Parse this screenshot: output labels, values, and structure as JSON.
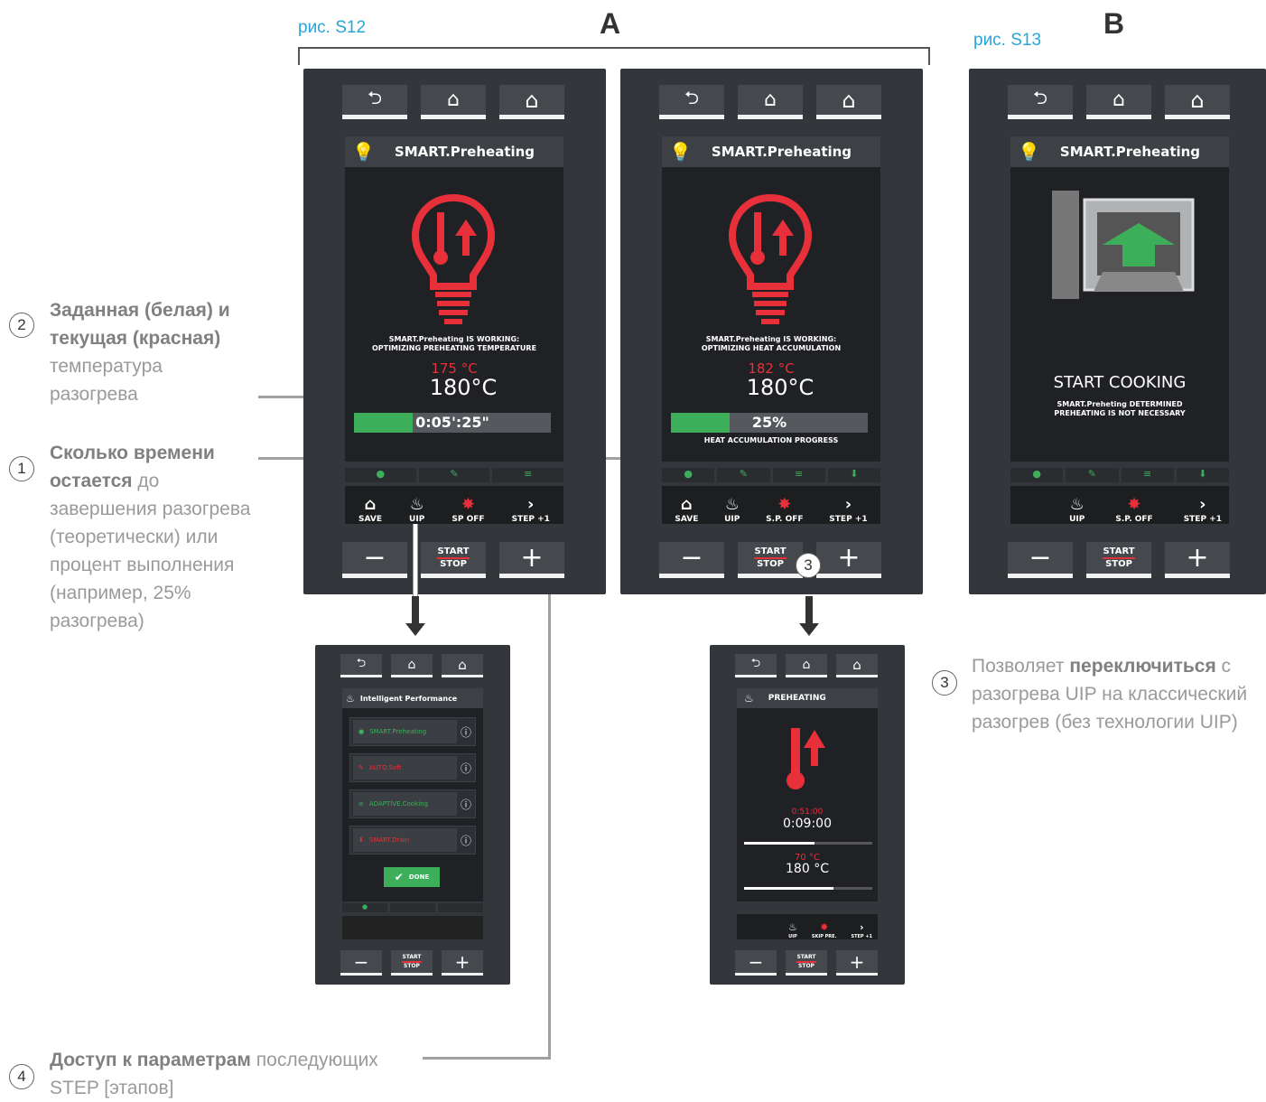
{
  "labels": {
    "fig_s12": "рис. S12",
    "fig_s13": "рис. S13",
    "group_a": "A",
    "group_b": "B"
  },
  "annotations": [
    {
      "num": "2",
      "parts": [
        {
          "t": "Заданная (белая) и текущая (красная)",
          "b": false
        },
        {
          "t": " температура разогрева",
          "b": false
        }
      ]
    },
    {
      "num": "1",
      "bold": "Сколько времени остается",
      "rest": " до завершения разогрева (теоретически) или процент выполнения (например, 25% разогрева)"
    },
    {
      "num": "3",
      "pre": "Позволяет ",
      "bold": "переключиться",
      "rest": " с разогрева UIP на классический разогрев (без технологии UIP)"
    },
    {
      "num": "4",
      "bold": "Доступ к параметрам",
      "rest": " последующих STEP [этапов]"
    }
  ],
  "ann2_line1": "Заданная (белая) и",
  "ann2_line2": "текущая (красная)",
  "ann2_line3": "температура",
  "ann2_line4": "разогрева",
  "ann1_bold": "Сколько времени",
  "ann1_bold2": "остается",
  "ann1_r1": " до",
  "ann1_l3": "завершения разогрева",
  "ann1_l4": "(теоретически) или",
  "ann1_l5": "процент выполнения",
  "ann1_l6": "(например, 25%",
  "ann1_l7": "разогрева)",
  "ann3_pre": "Позволяет ",
  "ann3_bold": "переключиться",
  "ann3_r1": " с",
  "ann3_l2": "разогрева UIP на классический",
  "ann3_l3": "разогрев (без технологии UIP)",
  "ann4_bold": "Доступ к параметрам",
  "ann4_r1": " последующих",
  "ann4_l2": "STEP [этапов]",
  "nums": {
    "n1": "1",
    "n2": "2",
    "n3": "3",
    "n4": "4"
  },
  "panel1": {
    "title": "SMART.Preheating",
    "status1": "SMART.Preheating IS WORKING:",
    "status2": "OPTIMIZING PREHEATING TEMPERATURE",
    "current": "175 °C",
    "set": "180°C",
    "progress": "0:05':25\"",
    "progress_fraction": 0.3,
    "buttons": [
      {
        "icon": "home-my",
        "label": "SAVE"
      },
      {
        "icon": "uip",
        "label": "UIP"
      },
      {
        "icon": "sp-off",
        "label": "SP OFF"
      },
      {
        "icon": "chevron",
        "label": "STEP +1"
      }
    ]
  },
  "panel2": {
    "title": "SMART.Preheating",
    "status1": "SMART.Preheating IS WORKING:",
    "status2": "OPTIMIZING HEAT ACCUMULATION",
    "current": "182 °C",
    "set": "180°C",
    "progress": "25%",
    "progress_fraction": 0.3,
    "progress_label": "HEAT ACCUMULATION PROGRESS",
    "buttons": [
      {
        "label": "SAVE"
      },
      {
        "label": "UIP"
      },
      {
        "label": "S.P. OFF"
      },
      {
        "label": "STEP +1"
      }
    ]
  },
  "panel3": {
    "title": "SMART.Preheating",
    "main": "START COOKING",
    "sub1": "SMART.Preheting DETERMINED",
    "sub2": "PREHEATING IS NOT NECESSARY",
    "buttons": [
      {
        "label": "UIP"
      },
      {
        "label": "S.P. OFF"
      },
      {
        "label": "STEP +1"
      }
    ]
  },
  "panel4": {
    "title": "Intelligent Performance",
    "items": [
      "SMART.Preheating",
      "AUTO.Soft",
      "ADAPTIVE.Cooking",
      "SMART.Drain"
    ],
    "done": "DONE"
  },
  "panel5": {
    "title": "PREHEATING",
    "time_red": "0:51:00",
    "time": "0:09:00",
    "temp_red": "70 °C",
    "temp": "180 °C",
    "time_fraction": 0.55,
    "temp_fraction": 0.7,
    "buttons": [
      {
        "label": "UIP"
      },
      {
        "label": "SKIP PRE."
      },
      {
        "label": "STEP +1"
      }
    ]
  },
  "common": {
    "start": "START",
    "stop": "STOP",
    "minus": "−",
    "plus": "+",
    "back": "⮌",
    "home": "⌂"
  }
}
